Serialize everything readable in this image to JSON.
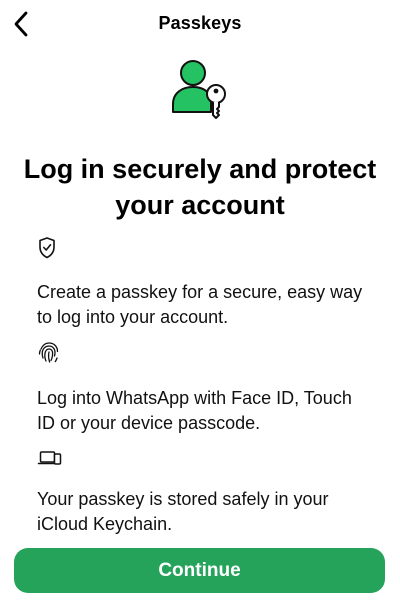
{
  "nav": {
    "title": "Passkeys",
    "back_icon": "chevron-left-icon"
  },
  "hero": {
    "icon": "user-key-icon",
    "accent_color": "#25c263"
  },
  "headline": "Log in securely and protect your account",
  "features": [
    {
      "icon": "shield-check-icon",
      "text": "Create a passkey for a secure, easy way to log into your account."
    },
    {
      "icon": "fingerprint-icon",
      "text": "Log into WhatsApp with Face ID, Touch ID or your device passcode."
    },
    {
      "icon": "devices-icon",
      "text": "Your passkey is stored safely in your iCloud Keychain."
    }
  ],
  "continue_button": {
    "label": "Continue",
    "color": "#25a35b"
  }
}
